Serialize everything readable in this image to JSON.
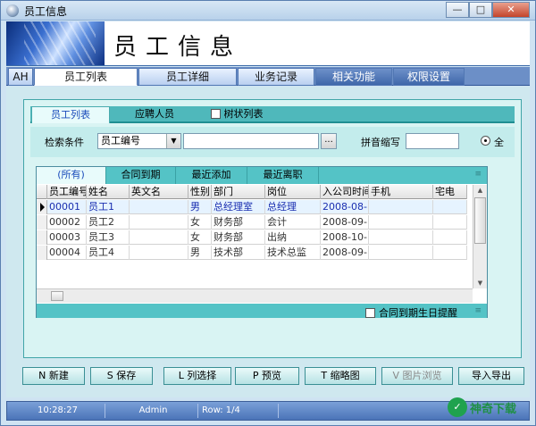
{
  "window": {
    "title": "员工信息",
    "min": "—",
    "max": "□",
    "close": "✕"
  },
  "banner": {
    "title": "员工信息"
  },
  "top_tabs": [
    {
      "label": "AH"
    },
    {
      "label": "员工列表"
    },
    {
      "label": "员工详细"
    },
    {
      "label": "业务记录"
    },
    {
      "label": "相关功能"
    },
    {
      "label": "权限设置"
    }
  ],
  "sub_tabs": {
    "list": "员工列表",
    "applicants": "应聘人员",
    "tree": "树状列表"
  },
  "search": {
    "field_label": "检索条件",
    "field_value": "员工编号",
    "keyword_value": "",
    "dots": "...",
    "pinyin_label": "拼音缩写",
    "pinyin_value": "",
    "radio_label": "全"
  },
  "filter_tabs": [
    "(所有)",
    "合同到期",
    "最近添加",
    "最近离职"
  ],
  "columns": [
    "员工编号",
    "姓名",
    "英文名",
    "性别",
    "部门",
    "岗位",
    "入公司时间",
    "手机",
    "宅电"
  ],
  "rows": [
    [
      "00001",
      "员工1",
      "",
      "男",
      "总经理室",
      "总经理",
      "2008-08-",
      "",
      ""
    ],
    [
      "00002",
      "员工2",
      "",
      "女",
      "财务部",
      "会计",
      "2008-09-",
      "",
      ""
    ],
    [
      "00003",
      "员工3",
      "",
      "女",
      "财务部",
      "出纳",
      "2008-10-",
      "",
      ""
    ],
    [
      "00004",
      "员工4",
      "",
      "男",
      "技术部",
      "技术总监",
      "2008-09-",
      "",
      ""
    ]
  ],
  "grid_footer": {
    "birthday_reminder": "合同到期生日提醒"
  },
  "toolbar": [
    {
      "label": "N 新建"
    },
    {
      "label": "S 保存"
    },
    {
      "label": "L 列选择"
    },
    {
      "label": "P 预览"
    },
    {
      "label": "T 缩略图"
    },
    {
      "label": "V 图片浏览"
    },
    {
      "label": "导入导出"
    }
  ],
  "status": {
    "time": "10:28:27",
    "user": "Admin",
    "row": "Row: 1/4"
  },
  "watermark": {
    "text": "神奇下载"
  },
  "icons": {
    "app": "app-icon",
    "combo": "chevron-down-icon",
    "row_pointer": "row-pointer-icon",
    "scroll_up": "arrow-up-icon",
    "scroll_down": "arrow-down-icon",
    "collapse": "collapse-icon"
  },
  "colors": {
    "accent": "#54c3c6",
    "header_blue": "#4b74b8",
    "selected_text": "#1a2fb0"
  }
}
